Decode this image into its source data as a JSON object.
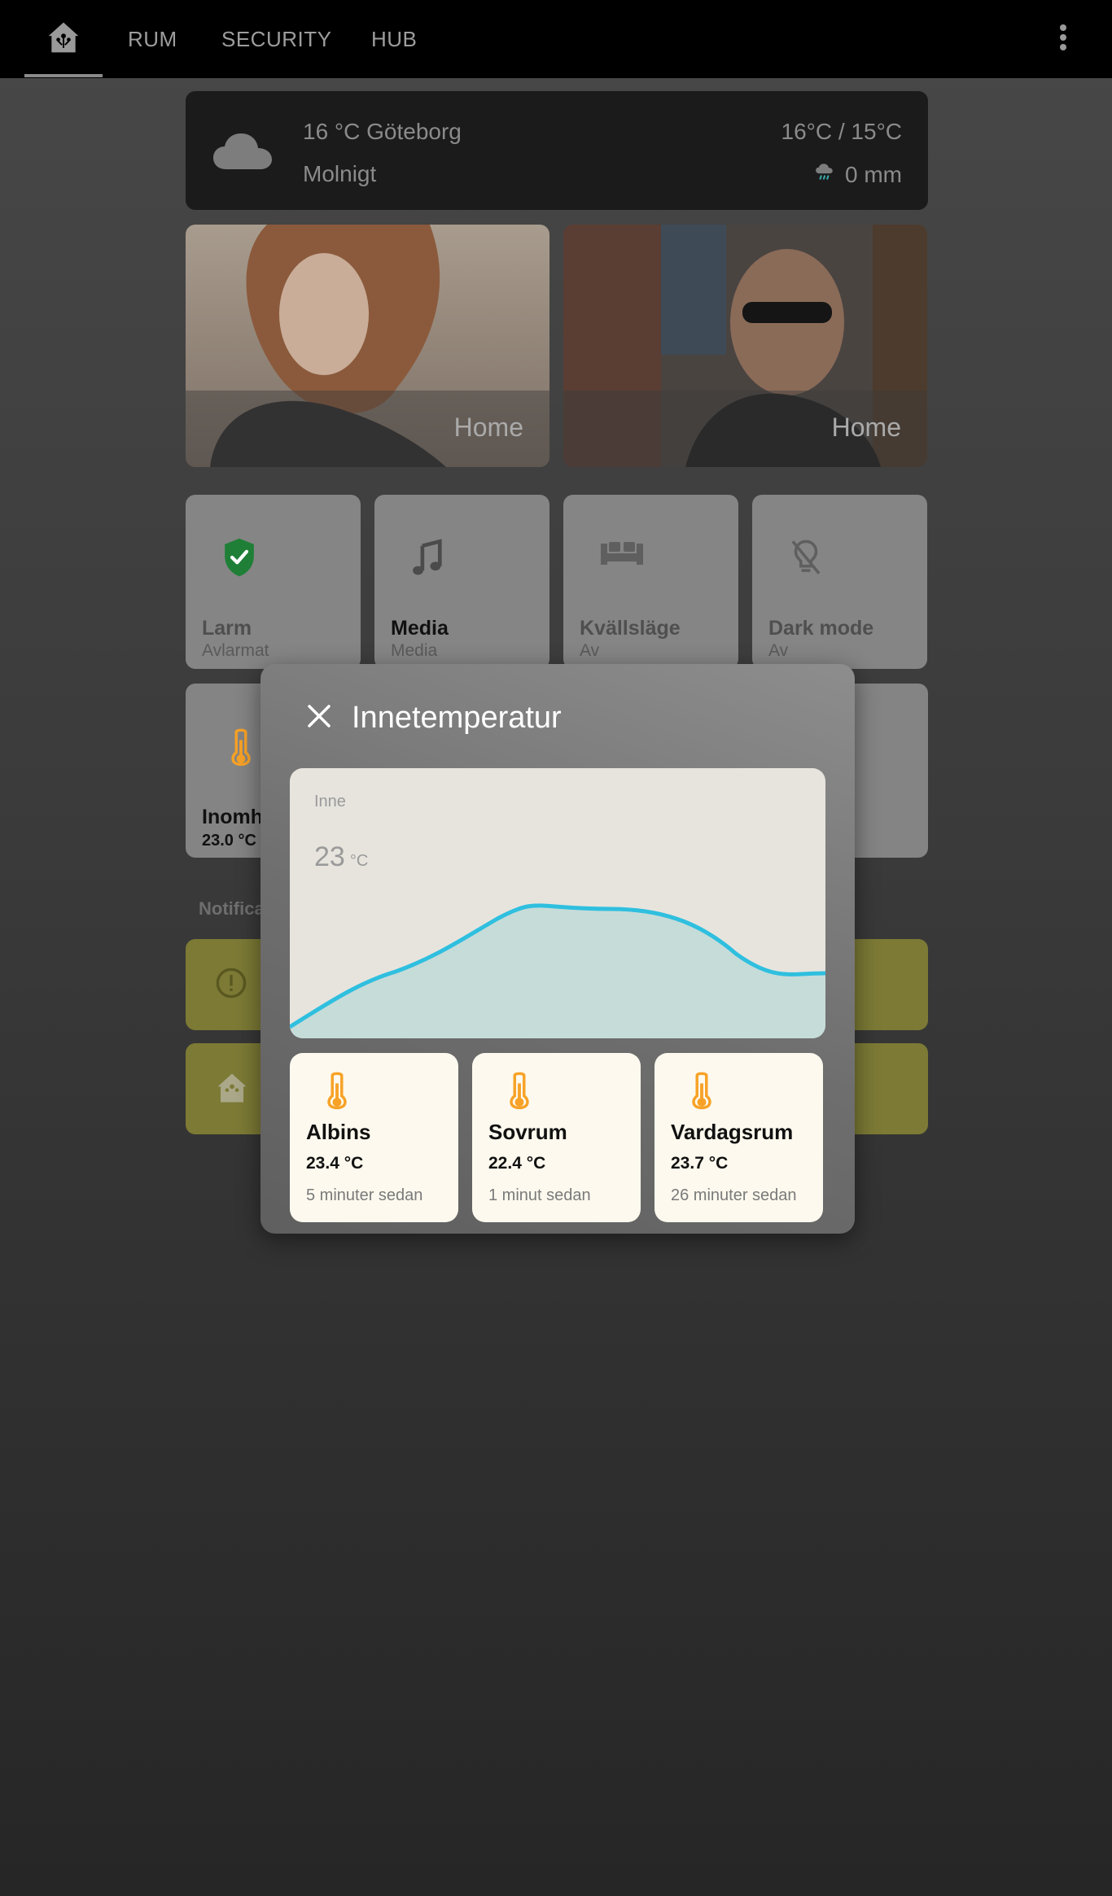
{
  "topbar": {
    "tabs": [
      "RUM",
      "SECURITY",
      "HUB"
    ],
    "home_icon": "home-assistant-icon",
    "menu_icon": "more-vertical-icon"
  },
  "weather": {
    "line1": "16 °C Göteborg",
    "condition": "Molnigt",
    "high_low": "16°C / 15°C",
    "precipitation": "0 mm",
    "icon": "cloud-icon"
  },
  "persons": [
    {
      "state": "Home"
    },
    {
      "state": "Home"
    }
  ],
  "buttons": [
    {
      "name": "Larm",
      "state": "Avlarmat",
      "icon": "shield-check-icon"
    },
    {
      "name": "Media",
      "state": "Media",
      "icon": "music-note-icon"
    },
    {
      "name": "Kvällsläge",
      "state": "Av",
      "icon": "sofa-icon"
    },
    {
      "name": "Dark mode",
      "state": "Av",
      "icon": "lightbulb-off-icon"
    }
  ],
  "row2": {
    "name": "Inomh",
    "value": "23.0 °C"
  },
  "notifications": {
    "title": "Notifica"
  },
  "dialog": {
    "title": "Innetemperatur",
    "graph": {
      "name": "Inne",
      "value": "23",
      "unit": "°C",
      "line_color": "#2fbfdf"
    },
    "sensors": [
      {
        "name": "Albins",
        "value": "23.4 °C",
        "time": "5 minuter sedan"
      },
      {
        "name": "Sovrum",
        "value": "22.4 °C",
        "time": "1 minut sedan"
      },
      {
        "name": "Vardagsrum",
        "value": "23.7 °C",
        "time": "26 minuter sedan"
      }
    ]
  },
  "colors": {
    "accent_green": "#2fa84f",
    "thermometer": "#f7a227",
    "notification_bg": "#7c7a35"
  }
}
